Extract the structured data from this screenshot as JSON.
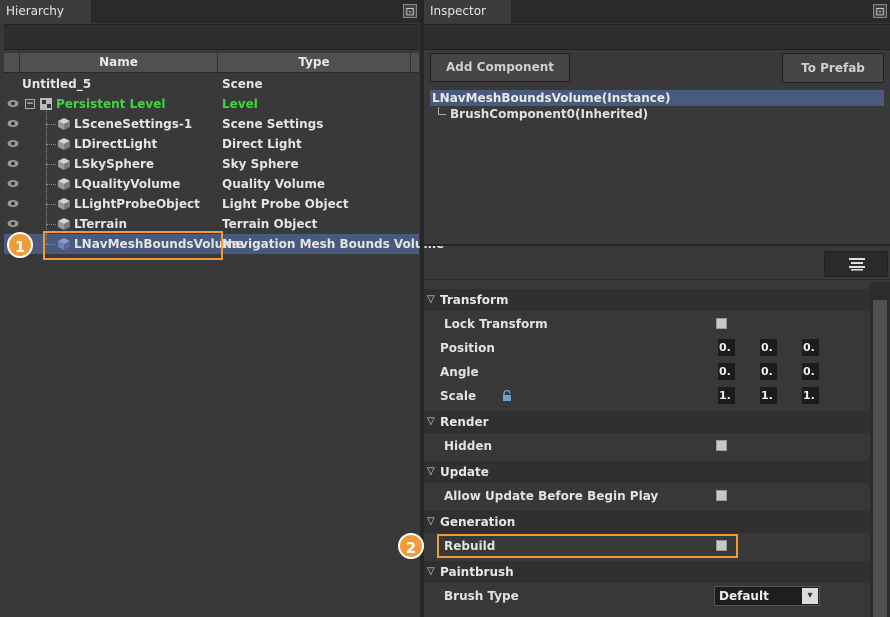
{
  "hierarchy": {
    "tab_title": "Hierarchy",
    "col_name": "Name",
    "col_type": "Type",
    "rows": [
      {
        "name": "Untitled_5",
        "type": "Scene"
      },
      {
        "name": "Persistent Level",
        "type": "Level"
      },
      {
        "name": "LSceneSettings-1",
        "type": "Scene Settings"
      },
      {
        "name": "LDirectLight",
        "type": "Direct Light"
      },
      {
        "name": "LSkySphere",
        "type": "Sky Sphere"
      },
      {
        "name": "LQualityVolume",
        "type": "Quality Volume"
      },
      {
        "name": "LLightProbeObject",
        "type": "Light Probe Object"
      },
      {
        "name": "LTerrain",
        "type": "Terrain Object"
      },
      {
        "name": "LNavMeshBoundsVolume",
        "type": "Navigation Mesh Bounds Volume"
      }
    ]
  },
  "inspector": {
    "tab_title": "Inspector",
    "add_component": "Add Component",
    "to_prefab": "To Prefab",
    "component_root": "LNavMeshBoundsVolume(Instance)",
    "component_child": "BrushComponent0(Inherited)",
    "sections": {
      "transform": "Transform",
      "render": "Render",
      "update": "Update",
      "generation": "Generation",
      "paintbrush": "Paintbrush"
    },
    "props": {
      "lock_transform": "Lock Transform",
      "position": "Position",
      "angle": "Angle",
      "scale": "Scale",
      "hidden": "Hidden",
      "allow_update": "Allow Update Before Begin Play",
      "rebuild": "Rebuild",
      "brush_type": "Brush Type",
      "brush_type_value": "Default"
    },
    "position_values": [
      "0.",
      "0.",
      "0."
    ],
    "angle_values": [
      "0.",
      "0.",
      "0."
    ],
    "scale_values": [
      "1.",
      "1.",
      "1."
    ]
  },
  "callouts": {
    "one": "1",
    "two": "2"
  },
  "colors": {
    "accent": "#f29a38",
    "selection": "#4a5a7d",
    "level_text": "#3ed63e"
  }
}
